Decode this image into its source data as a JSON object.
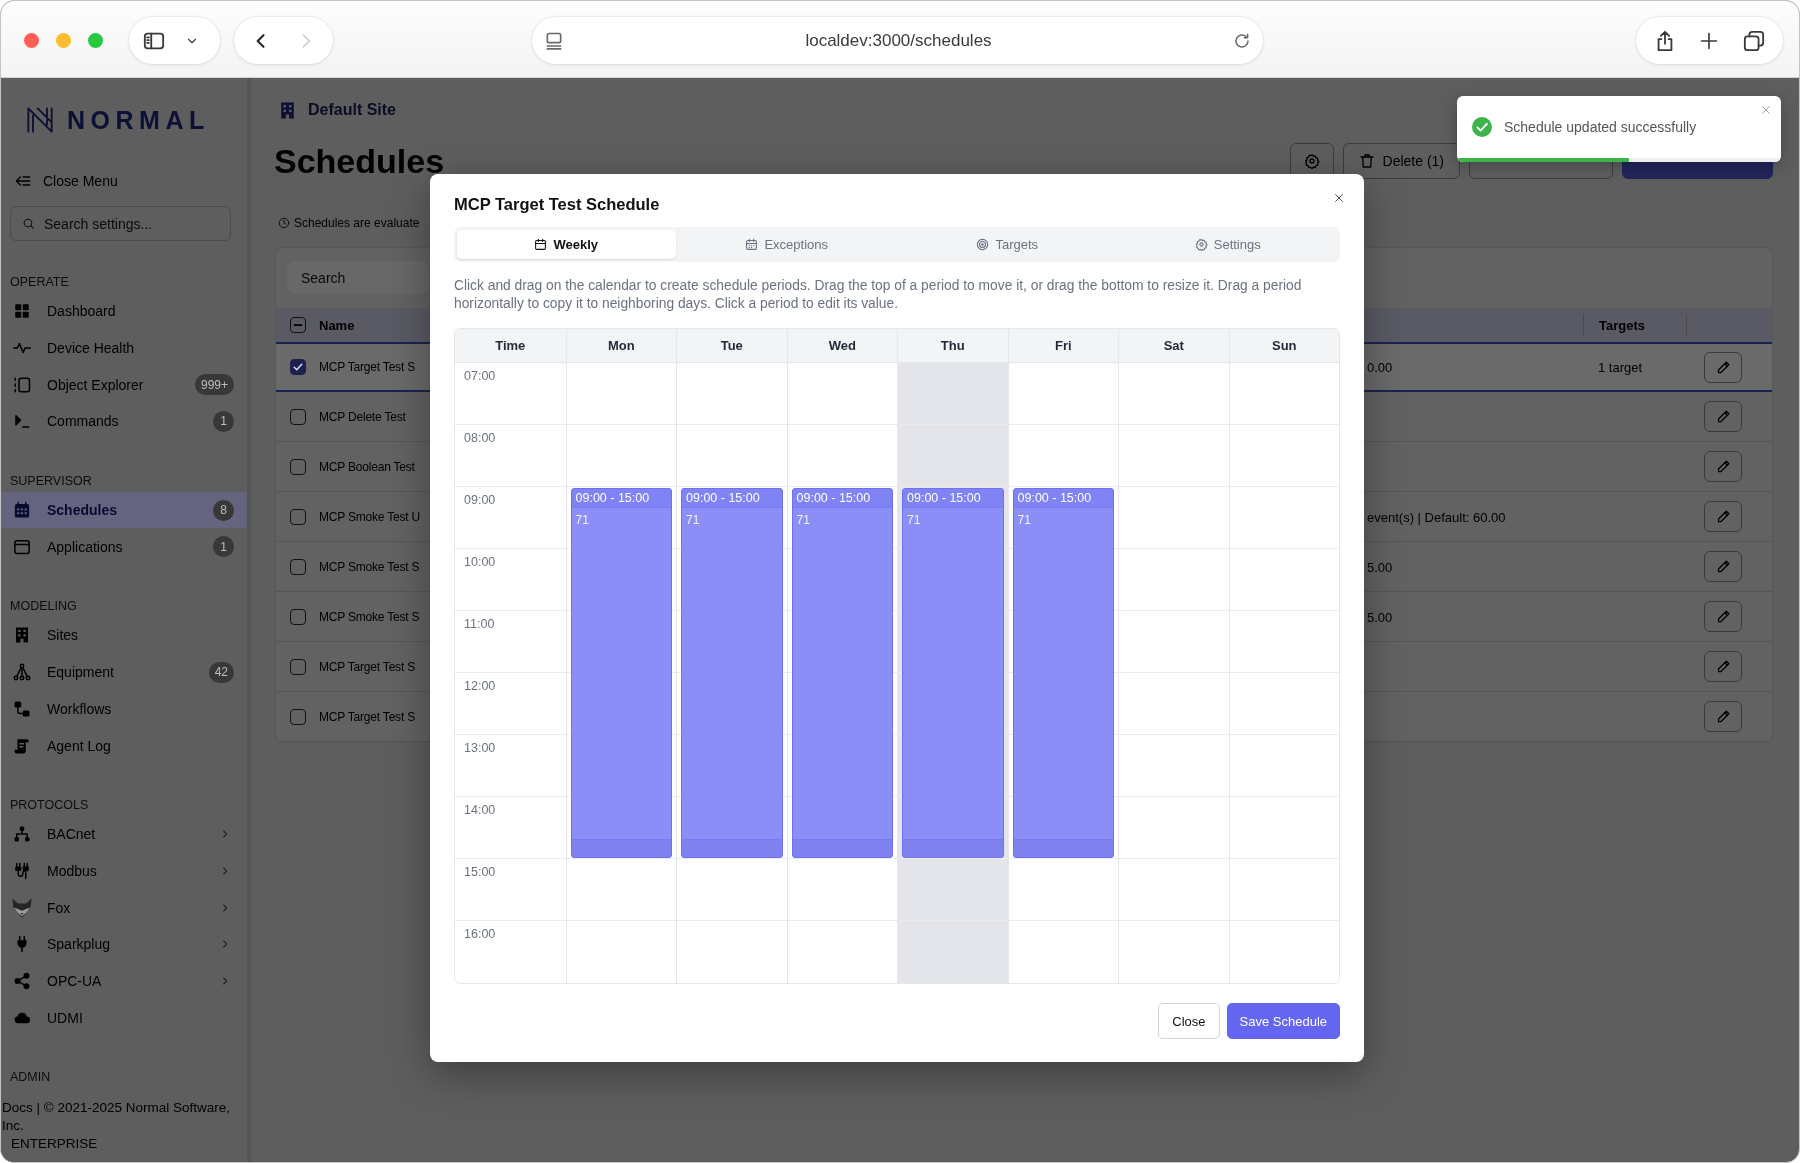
{
  "browser": {
    "url": "localdev:3000/schedules",
    "nav": [
      {
        "kind": "back",
        "disabled": false
      },
      {
        "kind": "forward",
        "disabled": true
      }
    ]
  },
  "sidebar": {
    "logo": "NORMAL",
    "close_menu": "Close Menu",
    "search": {
      "placeholder": "Search settings..."
    },
    "sections": [
      {
        "heading": "OPERATE",
        "items": [
          {
            "label": "Dashboard",
            "selected": false
          },
          {
            "label": "Device Health",
            "selected": false
          },
          {
            "label": "Object Explorer",
            "badge": "999+",
            "selected": false
          },
          {
            "label": "Commands",
            "badge": "1",
            "selected": false
          }
        ]
      },
      {
        "heading": "SUPERVISOR",
        "items": [
          {
            "label": "Schedules",
            "badge": "8",
            "selected": true
          },
          {
            "label": "Applications",
            "badge": "1",
            "selected": false
          }
        ]
      },
      {
        "heading": "MODELING",
        "items": [
          {
            "label": "Sites",
            "selected": false
          },
          {
            "label": "Equipment",
            "badge": "42",
            "selected": false
          },
          {
            "label": "Workflows",
            "selected": false
          },
          {
            "label": "Agent Log",
            "selected": false
          }
        ]
      },
      {
        "heading": "PROTOCOLS",
        "items": [
          {
            "label": "BACnet",
            "selected": false,
            "expandable": true
          },
          {
            "label": "Modbus",
            "selected": false,
            "expandable": true
          },
          {
            "label": "Fox",
            "selected": false,
            "expandable": true
          },
          {
            "label": "Sparkplug",
            "selected": false,
            "expandable": true
          },
          {
            "label": "OPC-UA",
            "selected": false,
            "expandable": true
          },
          {
            "label": "UDMI",
            "selected": false,
            "expandable": false
          }
        ]
      },
      {
        "heading": "ADMIN"
      }
    ],
    "footer": {
      "link": "Docs",
      "copyright": "| © 2021-2025 Normal Software, Inc.",
      "edition": "ENTERPRISE"
    }
  },
  "page": {
    "breadcrumb": "Default Site",
    "title": "Schedules",
    "toolbar": [
      {
        "kind": "settings"
      },
      {
        "kind": "delete",
        "label": "Delete (1)"
      },
      {
        "kind": "outline"
      },
      {
        "kind": "primary"
      }
    ],
    "info": "Schedules are evaluate",
    "search": {
      "placeholder": "Search"
    },
    "table": {
      "select_all": {
        "indeterminate": true
      },
      "columns": [
        "Name",
        "Targets"
      ],
      "rows": [
        {
          "selected": true,
          "name": "MCP Target Test S",
          "column_3": "0.00",
          "targets": "1 target"
        },
        {
          "selected": false,
          "name": "MCP Delete Test"
        },
        {
          "selected": false,
          "name": "MCP Boolean Test"
        },
        {
          "selected": false,
          "name": "MCP Smoke Test U",
          "column_3": "event(s) | Default: 60.00"
        },
        {
          "selected": false,
          "name": "MCP Smoke Test S",
          "column_3": "5.00"
        },
        {
          "selected": false,
          "name": "MCP Smoke Test S",
          "column_3": "5.00"
        },
        {
          "selected": false,
          "name": "MCP Target Test S"
        },
        {
          "selected": false,
          "name": "MCP Target Test S"
        }
      ]
    }
  },
  "modal": {
    "title": "MCP Target Test Schedule",
    "tabs": [
      {
        "label": "Weekly",
        "selected": true
      },
      {
        "label": "Exceptions",
        "selected": false
      },
      {
        "label": "Targets",
        "selected": false
      },
      {
        "label": "Settings",
        "selected": false
      }
    ],
    "description": "Click and drag on the calendar to create schedule periods. Drag the top of a period to move it, or drag the bottom to resize it. Drag a period horizontally to copy it to neighboring days. Click a period to edit its value.",
    "calendar": {
      "time_heading": "Time",
      "times": [
        "07:00",
        "08:00",
        "09:00",
        "10:00",
        "11:00",
        "12:00",
        "13:00",
        "14:00",
        "15:00",
        "16:00"
      ],
      "days": [
        {
          "name": "Mon",
          "today": false,
          "periods": [
            {
              "time": "09:00 - 15:00",
              "value": "71"
            }
          ]
        },
        {
          "name": "Tue",
          "today": false,
          "periods": [
            {
              "time": "09:00 - 15:00",
              "value": "71"
            }
          ]
        },
        {
          "name": "Wed",
          "today": false,
          "periods": [
            {
              "time": "09:00 - 15:00",
              "value": "71"
            }
          ]
        },
        {
          "name": "Thu",
          "today": true,
          "periods": [
            {
              "time": "09:00 - 15:00",
              "value": "71"
            }
          ]
        },
        {
          "name": "Fri",
          "today": false,
          "periods": [
            {
              "time": "09:00 - 15:00",
              "value": "71"
            }
          ]
        },
        {
          "name": "Sat",
          "today": false
        },
        {
          "name": "Sun",
          "today": false
        }
      ]
    },
    "buttons": [
      {
        "label": "Close",
        "kind": "secondary"
      },
      {
        "label": "Save Schedule",
        "kind": "primary"
      }
    ]
  },
  "toast": {
    "message": "Schedule updated successfully",
    "level": 0.53
  }
}
